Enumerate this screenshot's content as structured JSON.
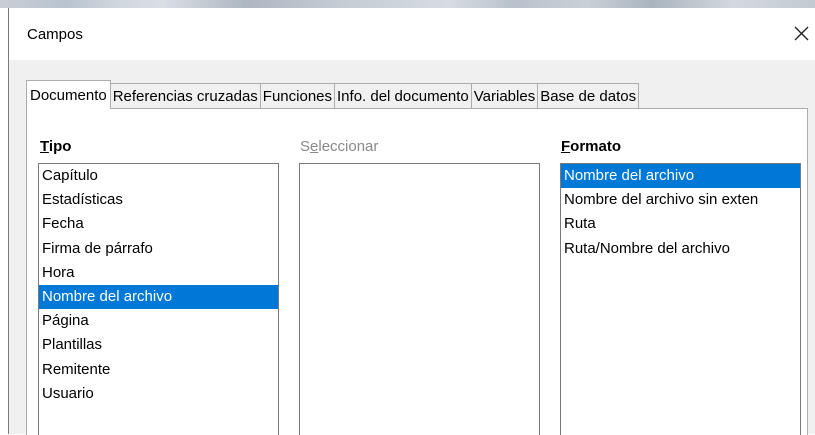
{
  "dialog": {
    "title": "Campos"
  },
  "tabs": [
    {
      "label": "Documento",
      "active": true
    },
    {
      "label": "Referencias cruzadas",
      "active": false
    },
    {
      "label": "Funciones",
      "active": false
    },
    {
      "label": "Info. del documento",
      "active": false
    },
    {
      "label": "Variables",
      "active": false
    },
    {
      "label": "Base de datos",
      "active": false
    }
  ],
  "tipo": {
    "label_mnemonic": "T",
    "label_rest": "ipo",
    "items": [
      "Capítulo",
      "Estadísticas",
      "Fecha",
      "Firma de párrafo",
      "Hora",
      "Nombre del archivo",
      "Página",
      "Plantillas",
      "Remitente",
      "Usuario"
    ],
    "selected": "Nombre del archivo"
  },
  "seleccionar": {
    "label_pre": "S",
    "label_mnemonic": "e",
    "label_rest": "leccionar",
    "items": []
  },
  "formato": {
    "label_mnemonic": "F",
    "label_rest": "ormato",
    "items": [
      "Nombre del archivo",
      "Nombre del archivo sin exten",
      "Ruta",
      "Ruta/Nombre del archivo"
    ],
    "selected": "Nombre del archivo"
  },
  "colors": {
    "selection": "#0078d7",
    "disabled_text": "#8a8a8a"
  },
  "icons": {
    "close": "close-icon"
  }
}
